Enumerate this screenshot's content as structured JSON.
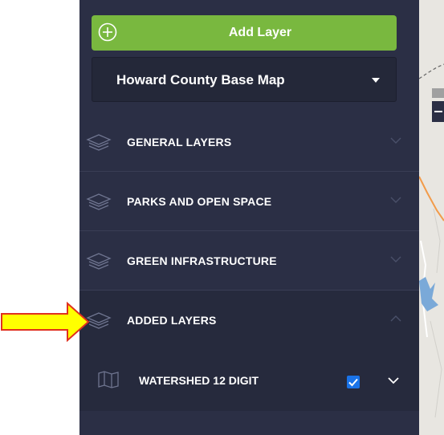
{
  "toolbar": {
    "add_layer_label": "Add Layer"
  },
  "basemap": {
    "selected": "Howard County Base Map"
  },
  "sections": [
    {
      "label": "GENERAL LAYERS",
      "expanded": false
    },
    {
      "label": "PARKS AND OPEN SPACE",
      "expanded": false
    },
    {
      "label": "GREEN INFRASTRUCTURE",
      "expanded": false
    },
    {
      "label": "ADDED LAYERS",
      "expanded": true
    }
  ],
  "added_layers": [
    {
      "label": "WATERSHED 12 DIGIT",
      "checked": true
    }
  ],
  "icons": {
    "add": "plus-circle-icon",
    "section": "layers-icon",
    "layer": "map-icon",
    "pointer": "arrow-right-icon"
  },
  "colors": {
    "panel": "#2b2f45",
    "accent_green": "#79b83f",
    "checkbox_blue": "#1a73e8",
    "arrow_yellow": "#ffff00",
    "arrow_outline": "#e0301e"
  }
}
